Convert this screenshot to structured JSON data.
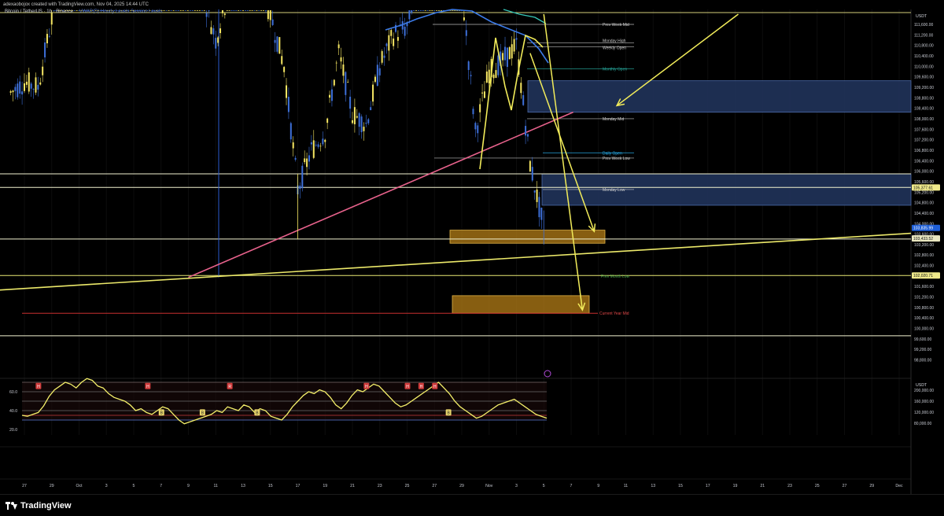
{
  "header": {
    "created_by": "adexaobojox created with TradingView.com, Nov 04, 2025 14:44 UTC",
    "symbol": "Bitcoin / TetherUS · 1h · Binance",
    "indicators_label": "VWAP(D) Hourly Levels Session Levels"
  },
  "brand": {
    "name": "TradingView"
  },
  "colors": {
    "background": "#000000",
    "candle_up": "#f5e663",
    "candle_down": "#3d6fd8",
    "level_line": "#f2f2d0",
    "trend_pink": "#e8628c",
    "trend_yellow": "#ece96a",
    "arrow_yellow": "#f2ec5a",
    "zone_blue": "#22365f",
    "zone_orange": "#b47d17",
    "current_price": "#1f5fd6",
    "current_year_mid": "#c92f2f",
    "prev_month_low": "#4cae4c",
    "monthly_open": "#26a69a",
    "daily_open": "#29b6f6"
  },
  "chart_data": [
    {
      "type": "line",
      "title": "",
      "currency": "USDT",
      "ylim": [
        98800,
        112000
      ],
      "y_ticks": [
        "111,600.00",
        "111,200.00",
        "110,800.00",
        "110,400.00",
        "110,000.00",
        "109,600.00",
        "109,200.00",
        "108,800.00",
        "108,400.00",
        "108,000.00",
        "107,600.00",
        "107,200.00",
        "106,800.00",
        "106,400.00",
        "106,000.00",
        "105,600.00",
        "105,200.00",
        "104,800.00",
        "104,400.00",
        "104,000.00",
        "103,600.00",
        "103,200.00",
        "102,800.00",
        "102,400.00",
        "102,000.00",
        "101,600.00",
        "101,200.00",
        "100,800.00",
        "100,400.00",
        "100,000.00",
        "99,600.00",
        "99,200.00",
        "98,800.00"
      ],
      "x_ticks": [
        "27",
        "29",
        "Oct",
        "3",
        "5",
        "7",
        "9",
        "11",
        "13",
        "15",
        "17",
        "19",
        "21",
        "23",
        "25",
        "27",
        "29",
        "Nov",
        "3",
        "5",
        "7",
        "9",
        "11",
        "13",
        "15",
        "17",
        "19",
        "21",
        "23",
        "25",
        "27",
        "29",
        "Dec"
      ],
      "price_series": [
        {
          "x": "Sep 26",
          "y": 109000
        },
        {
          "x": "Sep 27",
          "y": 109400
        },
        {
          "x": "Sep 28",
          "y": 109200
        },
        {
          "x": "Sep 29",
          "y": 111800
        },
        {
          "x": "Oct 1",
          "y": 117000
        },
        {
          "x": "Oct 6",
          "y": 125000
        },
        {
          "x": "Oct 10",
          "y": 113000
        },
        {
          "x": "Oct 11",
          "y": 111000
        },
        {
          "x": "Oct 13",
          "y": 115000
        },
        {
          "x": "Oct 15",
          "y": 112000
        },
        {
          "x": "Oct 16",
          "y": 110000
        },
        {
          "x": "Oct 17",
          "y": 105300
        },
        {
          "x": "Oct 18",
          "y": 106800
        },
        {
          "x": "Oct 19",
          "y": 107500
        },
        {
          "x": "Oct 20",
          "y": 110500
        },
        {
          "x": "Oct 21",
          "y": 108200
        },
        {
          "x": "Oct 22",
          "y": 107800
        },
        {
          "x": "Oct 23",
          "y": 110000
        },
        {
          "x": "Oct 24",
          "y": 111200
        },
        {
          "x": "Oct 25",
          "y": 111500
        },
        {
          "x": "Oct 26",
          "y": 113800
        },
        {
          "x": "Oct 27",
          "y": 115300
        },
        {
          "x": "Oct 28",
          "y": 112800
        },
        {
          "x": "Oct 29",
          "y": 113000
        },
        {
          "x": "Oct 30",
          "y": 107500
        },
        {
          "x": "Oct 31",
          "y": 109800
        },
        {
          "x": "Nov 1",
          "y": 110200
        },
        {
          "x": "Nov 2",
          "y": 110800
        },
        {
          "x": "Nov 3",
          "y": 106300
        },
        {
          "x": "Nov 4",
          "y": 103750
        }
      ],
      "levels": [
        {
          "label": "Prev Week Mid",
          "value": 111600,
          "color": "#cfcfcf"
        },
        {
          "label": "Monday High",
          "value": 110900,
          "color": "#cfcfcf"
        },
        {
          "label": "Weekly Open",
          "value": 110750,
          "color": "#cfcfcf"
        },
        {
          "label": "Monthly Open",
          "value": 109900,
          "color": "#26a69a"
        },
        {
          "label": "Monday Mid",
          "value": 108000,
          "color": "#cfcfcf"
        },
        {
          "label": "Daily Open",
          "value": 106700,
          "color": "#29b6f6"
        },
        {
          "label": "Prev Week Low",
          "value": 106500,
          "color": "#cfcfcf"
        },
        {
          "label": "Monday Low",
          "value": 105300,
          "color": "#cfcfcf"
        },
        {
          "label": "Prev Month Low",
          "value": 102000,
          "color": "#4cae4c"
        },
        {
          "label": "Current Year Mid",
          "value": 100580,
          "color": "#e04848"
        }
      ],
      "horizontal_lines": [
        105900,
        105380,
        103410,
        102020,
        99720,
        112000
      ],
      "price_labels": [
        {
          "value": 105377.61,
          "text": "105,377.61",
          "style": "yellow"
        },
        {
          "value": 103835.99,
          "text": "103,835.99",
          "style": "blue"
        },
        {
          "value": 103433.52,
          "text": "103,433.52",
          "style": "light"
        },
        {
          "value": 102020.71,
          "text": "102,020.71",
          "style": "yellow"
        }
      ],
      "zones": [
        {
          "kind": "supply",
          "y_from": 108250,
          "y_to": 109450
        },
        {
          "kind": "supply",
          "y_from": 104700,
          "y_to": 105900
        },
        {
          "kind": "demand",
          "y_from": 103250,
          "y_to": 103750
        },
        {
          "kind": "demand",
          "y_from": 100580,
          "y_to": 101250
        }
      ],
      "trendlines": [
        {
          "color": "pink",
          "from": {
            "x": "Oct 9",
            "y": 101950
          },
          "to": {
            "x": "Nov 5",
            "y": 108250
          }
        },
        {
          "color": "yellow",
          "from": {
            "x": "Sep 25",
            "y": 101460
          },
          "to": {
            "x": "Dec 1",
            "y": 103630
          }
        }
      ],
      "arrows": [
        {
          "from": {
            "x": "Nov 18",
            "y": 112000
          },
          "to": {
            "x": "Nov 9",
            "y": 108500
          }
        },
        {
          "from": {
            "x": "Nov 3",
            "y": 110500
          },
          "to": {
            "x": "Nov 7",
            "y": 103700
          }
        },
        {
          "from": {
            "x": "Nov 4",
            "y": 112000
          },
          "to": {
            "x": "Nov 7",
            "y": 100700
          }
        }
      ]
    },
    {
      "type": "line",
      "title": "",
      "currency": "USDT",
      "y_ticks": [
        "60.0",
        "40.0",
        "20.0"
      ],
      "right_ticks": [
        "200,000.00",
        "160,000.00",
        "120,000.00",
        "80,000.00"
      ],
      "ylim": [
        15,
        75
      ],
      "bands": [
        70,
        60,
        50,
        40,
        35,
        30
      ],
      "series": [
        {
          "values": [
            35,
            34,
            36,
            38,
            45,
            55,
            62,
            66,
            70,
            68,
            64,
            70,
            74,
            72,
            66,
            64,
            58,
            54,
            52,
            50,
            46,
            40,
            42,
            38,
            36,
            40,
            44,
            42,
            36,
            30,
            26,
            28,
            30,
            32,
            34,
            36,
            40,
            38,
            44,
            42,
            40,
            46,
            44,
            38,
            42,
            40,
            34,
            32,
            30,
            36,
            44,
            50,
            56,
            60,
            58,
            62,
            60,
            54,
            46,
            42,
            48,
            56,
            62,
            60,
            64,
            68,
            66,
            60,
            54,
            48,
            44,
            46,
            50,
            54,
            58,
            62,
            66,
            70,
            64,
            58,
            50,
            44,
            40,
            36,
            32,
            34,
            38,
            42,
            46,
            48,
            50,
            52,
            48,
            44,
            40,
            36,
            34,
            32
          ]
        }
      ],
      "markers": [
        {
          "label": "H",
          "at": "Sep 28"
        },
        {
          "label": "H",
          "at": "Oct 6"
        },
        {
          "label": "B",
          "at": "Oct 7"
        },
        {
          "label": "B",
          "at": "Oct 10"
        },
        {
          "label": "R",
          "at": "Oct 12"
        },
        {
          "label": "B",
          "at": "Oct 14"
        },
        {
          "label": "H",
          "at": "Oct 22"
        },
        {
          "label": "H",
          "at": "Oct 25"
        },
        {
          "label": "H",
          "at": "Oct 26"
        },
        {
          "label": "H",
          "at": "Oct 27"
        },
        {
          "label": "B",
          "at": "Oct 28"
        }
      ]
    }
  ]
}
